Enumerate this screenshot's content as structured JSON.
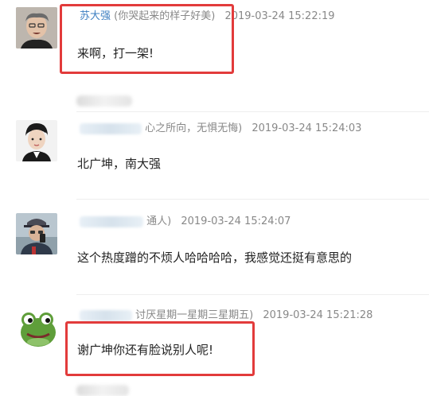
{
  "comments": [
    {
      "username": "苏大强",
      "nickname": "(你哭起来的样子好美)",
      "time": "2019-03-24 15:22:19",
      "text": "来啊，打一架!",
      "avatar_icon": "old-man-avatar-icon"
    },
    {
      "username": "",
      "nickname": "心之所向，无惧无悔)",
      "time": "2019-03-24 15:24:03",
      "text": "北广坤，南大强",
      "avatar_icon": "actor-avatar-icon"
    },
    {
      "username": "",
      "nickname": "通人)",
      "time": "2019-03-24 15:24:07",
      "text": "这个热度蹭的不烦人哈哈哈哈，我感觉还挺有意思的",
      "avatar_icon": "man-on-phone-avatar-icon"
    },
    {
      "username": "",
      "nickname": "讨厌星期一星期三星期五)",
      "time": "2019-03-24 15:21:28",
      "text": "谢广坤你还有脸说别人呢!",
      "avatar_icon": "frog-avatar-icon"
    }
  ],
  "colors": {
    "username": "#3e7fc1",
    "meta": "#888888",
    "highlight": "#e23b3b"
  }
}
